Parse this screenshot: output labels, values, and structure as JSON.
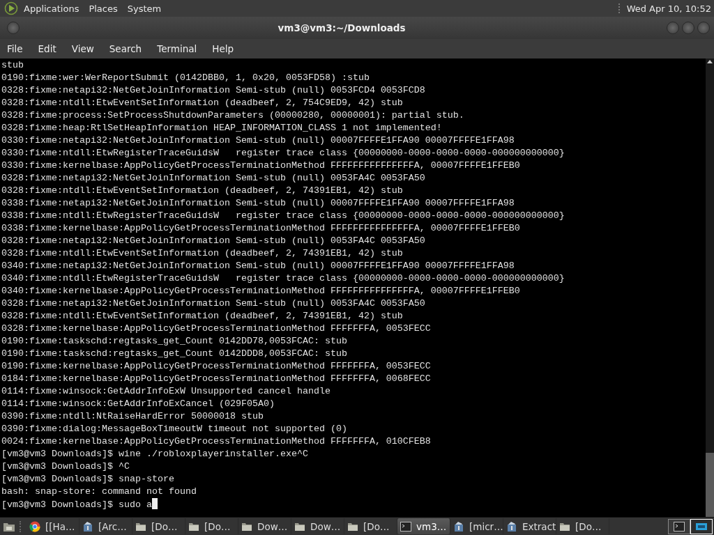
{
  "top_panel": {
    "menus": [
      "Applications",
      "Places",
      "System"
    ],
    "clock": "Wed Apr 10, 10:52"
  },
  "window": {
    "title": "vm3@vm3:~/Downloads"
  },
  "menu_bar": [
    "File",
    "Edit",
    "View",
    "Search",
    "Terminal",
    "Help"
  ],
  "terminal": {
    "cursor_visible": true,
    "lines": [
      "stub",
      "0190:fixme:wer:WerReportSubmit (0142DBB0, 1, 0x20, 0053FD58) :stub",
      "0328:fixme:netapi32:NetGetJoinInformation Semi-stub (null) 0053FCD4 0053FCD8",
      "0328:fixme:ntdll:EtwEventSetInformation (deadbeef, 2, 754C9ED9, 42) stub",
      "0328:fixme:process:SetProcessShutdownParameters (00000280, 00000001): partial stub.",
      "0328:fixme:heap:RtlSetHeapInformation HEAP_INFORMATION_CLASS 1 not implemented!",
      "0330:fixme:netapi32:NetGetJoinInformation Semi-stub (null) 00007FFFFE1FFA90 00007FFFFE1FFA98",
      "0330:fixme:ntdll:EtwRegisterTraceGuidsW   register trace class {00000000-0000-0000-0000-000000000000}",
      "0330:fixme:kernelbase:AppPolicyGetProcessTerminationMethod FFFFFFFFFFFFFFFA, 00007FFFFE1FFEB0",
      "0328:fixme:netapi32:NetGetJoinInformation Semi-stub (null) 0053FA4C 0053FA50",
      "0328:fixme:ntdll:EtwEventSetInformation (deadbeef, 2, 74391EB1, 42) stub",
      "0338:fixme:netapi32:NetGetJoinInformation Semi-stub (null) 00007FFFFE1FFA90 00007FFFFE1FFA98",
      "0338:fixme:ntdll:EtwRegisterTraceGuidsW   register trace class {00000000-0000-0000-0000-000000000000}",
      "0338:fixme:kernelbase:AppPolicyGetProcessTerminationMethod FFFFFFFFFFFFFFFA, 00007FFFFE1FFEB0",
      "0328:fixme:netapi32:NetGetJoinInformation Semi-stub (null) 0053FA4C 0053FA50",
      "0328:fixme:ntdll:EtwEventSetInformation (deadbeef, 2, 74391EB1, 42) stub",
      "0340:fixme:netapi32:NetGetJoinInformation Semi-stub (null) 00007FFFFE1FFA90 00007FFFFE1FFA98",
      "0340:fixme:ntdll:EtwRegisterTraceGuidsW   register trace class {00000000-0000-0000-0000-000000000000}",
      "0340:fixme:kernelbase:AppPolicyGetProcessTerminationMethod FFFFFFFFFFFFFFFA, 00007FFFFE1FFEB0",
      "0328:fixme:netapi32:NetGetJoinInformation Semi-stub (null) 0053FA4C 0053FA50",
      "0328:fixme:ntdll:EtwEventSetInformation (deadbeef, 2, 74391EB1, 42) stub",
      "0328:fixme:kernelbase:AppPolicyGetProcessTerminationMethod FFFFFFFA, 0053FECC",
      "0190:fixme:taskschd:regtasks_get_Count 0142DD78,0053FCAC: stub",
      "0190:fixme:taskschd:regtasks_get_Count 0142DDD8,0053FCAC: stub",
      "0190:fixme:kernelbase:AppPolicyGetProcessTerminationMethod FFFFFFFA, 0053FECC",
      "0184:fixme:kernelbase:AppPolicyGetProcessTerminationMethod FFFFFFFA, 0068FECC",
      "0114:fixme:winsock:GetAddrInfoExW Unsupported cancel handle",
      "0114:fixme:winsock:GetAddrInfoExCancel (029F05A0)",
      "0390:fixme:ntdll:NtRaiseHardError 50000018 stub",
      "0390:fixme:dialog:MessageBoxTimeoutW timeout not supported (0)",
      "0024:fixme:kernelbase:AppPolicyGetProcessTerminationMethod FFFFFFFA, 010CFEB8",
      "[vm3@vm3 Downloads]$ wine ./robloxplayerinstaller.exe^C",
      "[vm3@vm3 Downloads]$ ^C",
      "[vm3@vm3 Downloads]$ snap-store",
      "bash: snap-store: command not found",
      "[vm3@vm3 Downloads]$ sudo a"
    ]
  },
  "taskbar": {
    "windows": [
      {
        "label": "[[Ha…",
        "kind": "browser",
        "selected": false
      },
      {
        "label": "[Arc…",
        "kind": "archive",
        "selected": false
      },
      {
        "label": "[Do…",
        "kind": "folder",
        "selected": false
      },
      {
        "label": "[Do…",
        "kind": "folder",
        "selected": false
      },
      {
        "label": "Dow…",
        "kind": "folder",
        "selected": false
      },
      {
        "label": "Dow…",
        "kind": "folder",
        "selected": false
      },
      {
        "label": "[Do…",
        "kind": "folder",
        "selected": false
      },
      {
        "label": "vm3…",
        "kind": "terminal",
        "selected": true
      },
      {
        "label": "[micr…",
        "kind": "archive",
        "selected": false
      },
      {
        "label": "Extract",
        "kind": "archive",
        "selected": false
      },
      {
        "label": "[Do…",
        "kind": "folder",
        "selected": false
      }
    ],
    "workspaces": [
      {
        "kind": "terminal",
        "selected": false
      },
      {
        "kind": "screen",
        "selected": true
      }
    ]
  }
}
